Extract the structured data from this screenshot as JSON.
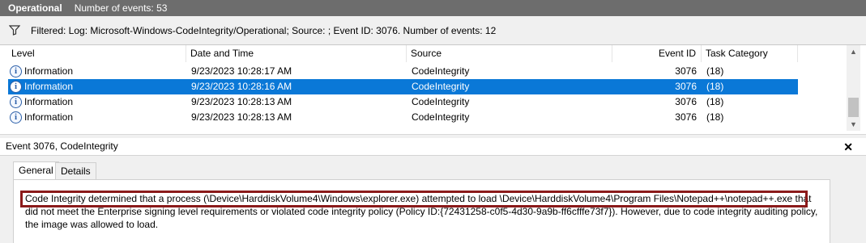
{
  "titlebar": {
    "log_name": "Operational",
    "event_count": "Number of events: 53"
  },
  "filter": {
    "text": "Filtered: Log: Microsoft-Windows-CodeIntegrity/Operational; Source: ; Event ID: 3076. Number of events: 12"
  },
  "columns": {
    "level": "Level",
    "datetime": "Date and Time",
    "source": "Source",
    "event_id": "Event ID",
    "task": "Task Category"
  },
  "rows": [
    {
      "level": "Information",
      "datetime": "9/23/2023 10:28:17 AM",
      "source": "CodeIntegrity",
      "event_id": "3076",
      "task": "(18)"
    },
    {
      "level": "Information",
      "datetime": "9/23/2023 10:28:16 AM",
      "source": "CodeIntegrity",
      "event_id": "3076",
      "task": "(18)"
    },
    {
      "level": "Information",
      "datetime": "9/23/2023 10:28:13 AM",
      "source": "CodeIntegrity",
      "event_id": "3076",
      "task": "(18)"
    },
    {
      "level": "Information",
      "datetime": "9/23/2023 10:28:13 AM",
      "source": "CodeIntegrity",
      "event_id": "3076",
      "task": "(18)"
    }
  ],
  "selected_row_index": 1,
  "detail": {
    "title": "Event 3076, CodeIntegrity",
    "close": "✕",
    "tabs": [
      "General",
      "Details"
    ],
    "message_line1": "Code Integrity determined that a process (\\Device\\HarddiskVolume4\\Windows\\explorer.exe) attempted to load \\Device\\HarddiskVolume4\\Program Files\\Notepad++\\notepad++.exe that",
    "message_line2": "did not meet the Enterprise signing level requirements or violated code integrity policy (Policy ID:{72431258-c0f5-4d30-9a9b-ff6cfffe73f7}). However, due to code integrity auditing policy,",
    "message_line3": "the image was allowed to load."
  },
  "info_icon_glyph": "i",
  "colors": {
    "selection": "#0a78d7",
    "highlight_box": "#8b1a1a",
    "titlebar": "#6d6d6d"
  }
}
